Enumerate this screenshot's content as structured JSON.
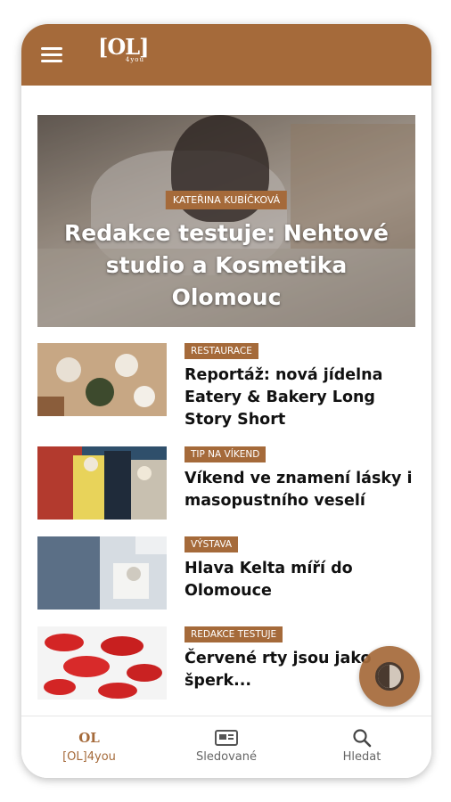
{
  "colors": {
    "brand": "#a56a3a",
    "background": "#ffffff",
    "text": "#111111"
  },
  "header": {
    "logo_text": "[OL]",
    "logo_sub": "4you",
    "menu_icon": "hamburger-icon"
  },
  "hero": {
    "category": "KATEŘINA KUBÍČKOVÁ",
    "title": "Redakce testuje: Nehtové studio a Kosmetika Olomouc"
  },
  "articles": [
    {
      "category": "RESTAURACE",
      "title": "Reportáž: nová jídelna Eatery & Bakery Long Story Short"
    },
    {
      "category": "TIP NA VÍKEND",
      "title": "Víkend ve znamení lásky i masopustního veselí"
    },
    {
      "category": "VÝSTAVA",
      "title": "Hlava Kelta míří do Olomouce"
    },
    {
      "category": "REDAKCE TESTUJE",
      "title": "Červené rty jsou jako šperk..."
    }
  ],
  "fab": {
    "icon": "contrast-toggle-icon"
  },
  "bottom_nav": [
    {
      "label": "[OL]4you",
      "icon": "home-logo-icon",
      "active": true
    },
    {
      "label": "Sledované",
      "icon": "newspaper-icon",
      "active": false
    },
    {
      "label": "Hledat",
      "icon": "search-icon",
      "active": false
    }
  ]
}
